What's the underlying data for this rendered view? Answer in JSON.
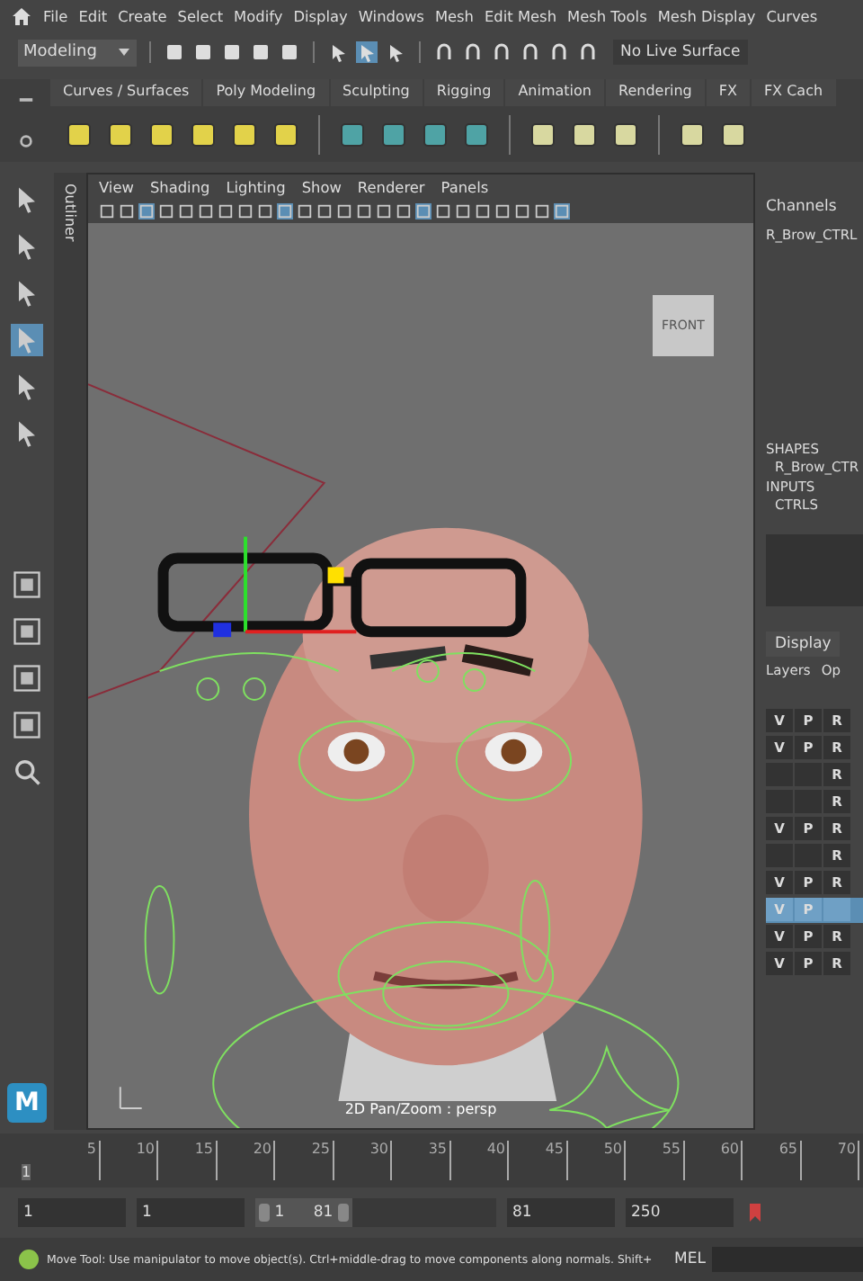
{
  "menu_bar": [
    "File",
    "Edit",
    "Create",
    "Select",
    "Modify",
    "Display",
    "Windows",
    "Mesh",
    "Edit Mesh",
    "Mesh Tools",
    "Mesh Display",
    "Curves"
  ],
  "toolbar": {
    "mode": "Modeling",
    "live_surface": "No Live Surface"
  },
  "shelf_tabs": [
    {
      "label": "Curves / Surfaces",
      "selected": false
    },
    {
      "label": "Poly Modeling",
      "selected": false
    },
    {
      "label": "Sculpting",
      "selected": false
    },
    {
      "label": "Rigging",
      "selected": false
    },
    {
      "label": "Animation",
      "selected": false
    },
    {
      "label": "Rendering",
      "selected": false
    },
    {
      "label": "FX",
      "selected": false
    },
    {
      "label": "FX Cach",
      "selected": false
    }
  ],
  "outliner_label": "Outliner",
  "viewport": {
    "menu": [
      "View",
      "Shading",
      "Lighting",
      "Show",
      "Renderer",
      "Panels"
    ],
    "view_cube": "FRONT",
    "camera_label": "2D Pan/Zoom : persp"
  },
  "channel_box": {
    "tab": "Channels",
    "object": "R_Brow_CTRL",
    "sections": [
      {
        "heading": "SHAPES",
        "item": "R_Brow_CTR"
      },
      {
        "heading": "INPUTS",
        "item": "CTRLS"
      }
    ]
  },
  "layer_editor": {
    "tab": "Display",
    "menu": [
      "Layers",
      "Op"
    ],
    "rows": [
      {
        "selected": false,
        "cells": [
          "V",
          "P",
          "R"
        ]
      },
      {
        "selected": false,
        "cells": [
          "V",
          "P",
          "R"
        ]
      },
      {
        "selected": false,
        "cells": [
          null,
          null,
          "R"
        ]
      },
      {
        "selected": false,
        "cells": [
          null,
          null,
          "R"
        ]
      },
      {
        "selected": false,
        "cells": [
          "V",
          "P",
          "R"
        ]
      },
      {
        "selected": false,
        "cells": [
          null,
          null,
          "R"
        ]
      },
      {
        "selected": false,
        "cells": [
          "V",
          "P",
          "R"
        ]
      },
      {
        "selected": true,
        "cells": [
          "V",
          "P",
          null
        ]
      },
      {
        "selected": false,
        "cells": [
          "V",
          "P",
          "R"
        ]
      },
      {
        "selected": false,
        "cells": [
          "V",
          "P",
          "R"
        ]
      }
    ]
  },
  "logo": "M",
  "timeline": {
    "current_frame": "1",
    "ticks": [
      "5",
      "10",
      "15",
      "20",
      "25",
      "30",
      "35",
      "40",
      "45",
      "50",
      "55",
      "60",
      "65",
      "70"
    ]
  },
  "range": {
    "start": "1",
    "playback_start": "1",
    "slider_start": "1",
    "slider_end": "81",
    "playback_end": "81",
    "end": "250"
  },
  "status_bar": {
    "message": "Move Tool: Use manipulator to move object(s). Ctrl+middle-drag to move components along normals. Shift+",
    "command_label": "MEL"
  }
}
